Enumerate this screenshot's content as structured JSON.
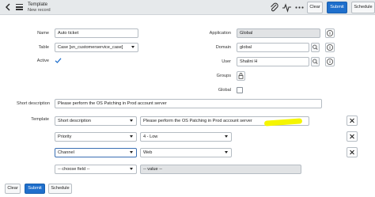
{
  "header": {
    "title": "Template",
    "subtitle": "New record",
    "buttons": {
      "clear": "Clear",
      "submit": "Submit",
      "schedule": "Schedule"
    }
  },
  "form": {
    "name": {
      "label": "Name",
      "value": "Auto ticket"
    },
    "table": {
      "label": "Table",
      "value": "Case [sn_customerservice_case]"
    },
    "active": {
      "label": "Active",
      "checked": true
    },
    "application": {
      "label": "Application",
      "value": "Global"
    },
    "domain": {
      "label": "Domain",
      "value": "global"
    },
    "user": {
      "label": "User",
      "value": "Shalini H"
    },
    "groups": {
      "label": "Groups"
    },
    "global": {
      "label": "Global",
      "checked": false
    },
    "short_description": {
      "label": "Short description",
      "value": "Please perform the OS Patching in Prod account server"
    }
  },
  "template": {
    "label": "Template",
    "rows": [
      {
        "field": "Short description",
        "value": "Please perform the OS Patching in  Prod account server"
      },
      {
        "field": "Priority",
        "value": "4 - Low"
      },
      {
        "field": "Channel",
        "value": "Web"
      }
    ],
    "new_row": {
      "field": "-- choose field --",
      "value": "-- value --"
    }
  },
  "footer": {
    "clear": "Clear",
    "submit": "Submit",
    "schedule": "Schedule"
  },
  "colors": {
    "primary": "#1f6fcc",
    "header_bg": "#e6e9eb",
    "highlight": "#f5f500"
  }
}
